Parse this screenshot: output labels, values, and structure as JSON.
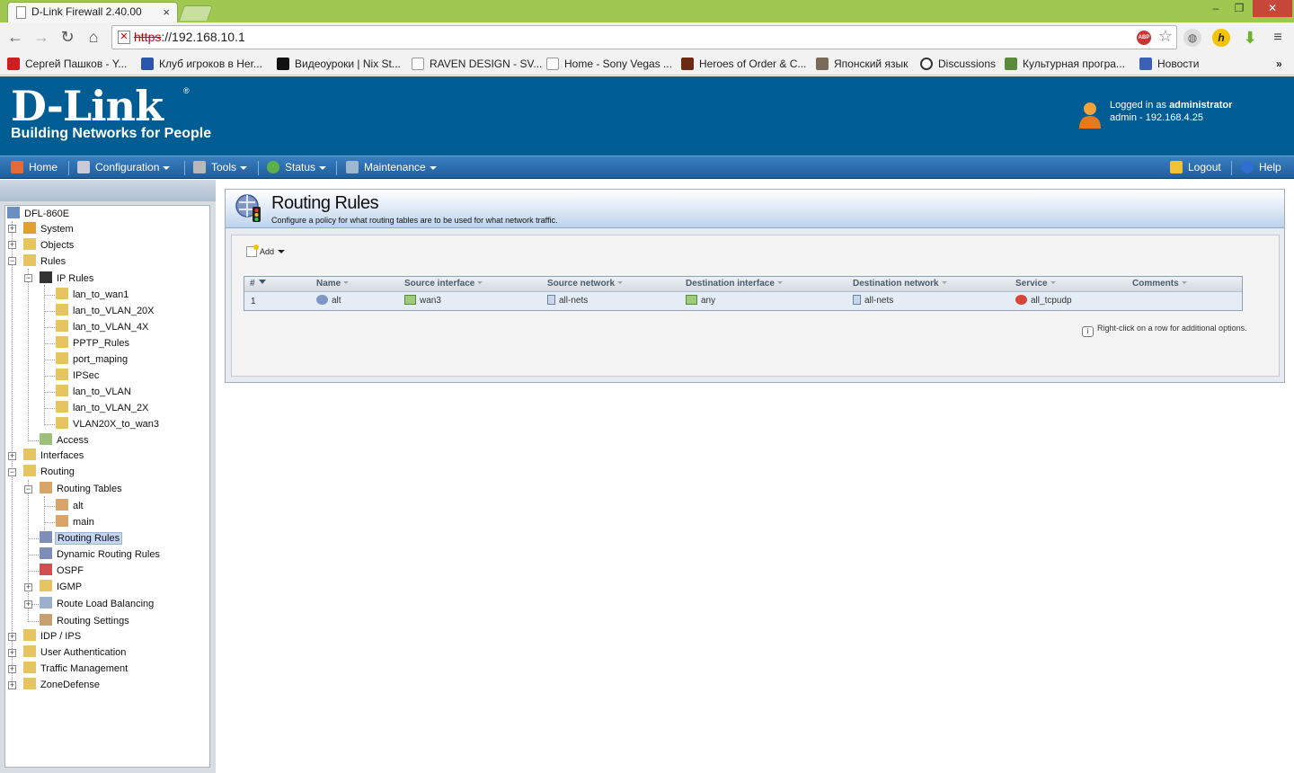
{
  "browser": {
    "tab_title": "D-Link Firewall 2.40.00",
    "url_scheme": "https",
    "url_rest": "://192.168.10.1",
    "bookmarks": [
      {
        "label": "Сергей Пашков - Y...",
        "icon": "youtube-icon",
        "color": "#cc1f1f"
      },
      {
        "label": "Клуб игроков в Her...",
        "icon": "forum-icon",
        "color": "#2a57a8"
      },
      {
        "label": "Видеоуроки | Nix St...",
        "icon": "nix-icon",
        "color": "#111111"
      },
      {
        "label": "RAVEN DESIGN - SV...",
        "icon": "page-icon",
        "color": "#ffffff"
      },
      {
        "label": "Home - Sony Vegas ...",
        "icon": "page-icon",
        "color": "#ffffff"
      },
      {
        "label": "Heroes of Order & C...",
        "icon": "game-icon",
        "color": "#6b2a14"
      },
      {
        "label": "Японский язык",
        "icon": "photo-icon",
        "color": "#7a6a5a"
      },
      {
        "label": "Discussions",
        "icon": "discussions-icon",
        "color": "#333333"
      },
      {
        "label": "Культурная програ...",
        "icon": "plant-icon",
        "color": "#5a8a3a"
      },
      {
        "label": "Новости",
        "icon": "news-icon",
        "color": "#3a62b0"
      }
    ],
    "more_bookmarks": "»"
  },
  "header": {
    "brand": "D-Link",
    "reg": "®",
    "tagline": "Building Networks for People",
    "login_prefix": "Logged in as",
    "login_user": "administrator",
    "login_detail": "admin - 192.168.4.25"
  },
  "menu": {
    "home": "Home",
    "configuration": "Configuration",
    "tools": "Tools",
    "status": "Status",
    "maintenance": "Maintenance",
    "logout": "Logout",
    "help": "Help"
  },
  "tree": [
    {
      "label": "DFL-860E"
    },
    {
      "label": "System"
    },
    {
      "label": "Objects"
    },
    {
      "label": "Rules"
    },
    {
      "label": "IP Rules"
    },
    {
      "label": "lan_to_wan1"
    },
    {
      "label": "lan_to_VLAN_20X"
    },
    {
      "label": "lan_to_VLAN_4X"
    },
    {
      "label": "PPTP_Rules"
    },
    {
      "label": "port_maping"
    },
    {
      "label": "IPSec"
    },
    {
      "label": "lan_to_VLAN"
    },
    {
      "label": "lan_to_VLAN_2X"
    },
    {
      "label": "VLAN20X_to_wan3"
    },
    {
      "label": "Access"
    },
    {
      "label": "Interfaces"
    },
    {
      "label": "Routing"
    },
    {
      "label": "Routing Tables"
    },
    {
      "label": "alt"
    },
    {
      "label": "main"
    },
    {
      "label": "Routing Rules"
    },
    {
      "label": "Dynamic Routing Rules"
    },
    {
      "label": "OSPF"
    },
    {
      "label": "IGMP"
    },
    {
      "label": "Route Load Balancing"
    },
    {
      "label": "Routing Settings"
    },
    {
      "label": "IDP / IPS"
    },
    {
      "label": "User Authentication"
    },
    {
      "label": "Traffic Management"
    },
    {
      "label": "ZoneDefense"
    }
  ],
  "page": {
    "title": "Routing Rules",
    "subtitle": "Configure a policy for what routing tables are to be used for what network traffic.",
    "add_label": "Add",
    "hint": "Right-click on a row for additional options."
  },
  "grid": {
    "columns": [
      "#",
      "Name",
      "Source interface",
      "Source network",
      "Destination interface",
      "Destination network",
      "Service",
      "Comments"
    ],
    "rows": [
      {
        "num": "1",
        "name": "alt",
        "src_if": "wan3",
        "src_net": "all-nets",
        "dst_if": "any",
        "dst_net": "all-nets",
        "service": "all_tcpudp",
        "comments": ""
      }
    ]
  }
}
